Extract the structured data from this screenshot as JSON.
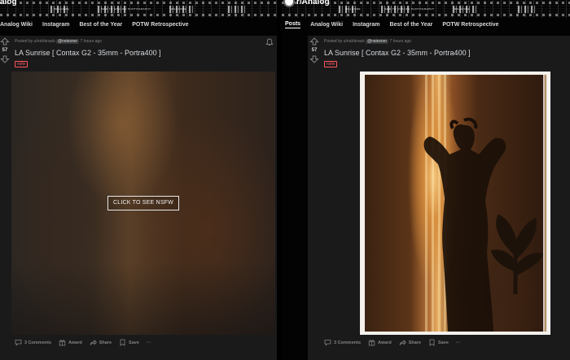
{
  "left": {
    "banner": {
      "brand": "alog",
      "tiny_texts": [
        "WELCOME",
        "NEW TO ANALOG PHOTOGRAPHY",
        "WELCOME"
      ]
    },
    "nav": [
      {
        "label": "Analog Wiki"
      },
      {
        "label": "Instagram"
      },
      {
        "label": "Best of the Year"
      },
      {
        "label": "POTW Retrospective"
      }
    ],
    "post": {
      "score": "57",
      "meta_prefix": "Posted by u/nickknack",
      "mention": "@rwiesner",
      "time": "7 hours ago",
      "title": "LA Sunrise [ Contax G2 - 35mm - Portra400 ]",
      "badge": "nsfw",
      "nsfw_button": "CLICK TO SEE NSFW",
      "comments": "3 Comments",
      "award": "Award",
      "share": "Share",
      "save": "Save",
      "more": "···"
    }
  },
  "right": {
    "banner": {
      "brand": "r/Analog",
      "tiny_texts": [
        "WELCOME",
        "NEW TO ANALOG PHOTOGRAPHY",
        "WELCOME"
      ]
    },
    "nav": [
      {
        "label": "Posts",
        "active": true
      },
      {
        "label": "Analog Wiki"
      },
      {
        "label": "Instagram"
      },
      {
        "label": "Best of the Year"
      },
      {
        "label": "POTW Retrospective"
      }
    ],
    "post": {
      "score": "57",
      "meta_prefix": "Posted by u/nickknack",
      "mention": "@rwiesner",
      "time": "7 hours ago",
      "title": "LA Sunrise [ Contax G2 - 35mm - Portra400 ]",
      "badge": "nsfw",
      "comments": "3 Comments",
      "award": "Award",
      "share": "Share",
      "save": "Save",
      "more": "···"
    }
  },
  "colors": {
    "nsfw": "#ff585b",
    "post_bg": "#1a1a1b",
    "text": "#d7dadc",
    "muted": "#818384"
  },
  "icons": [
    "upvote-icon",
    "downvote-icon",
    "bell-icon",
    "comment-icon",
    "award-icon",
    "share-icon",
    "save-icon",
    "more-icon",
    "subreddit-logo-icon"
  ]
}
